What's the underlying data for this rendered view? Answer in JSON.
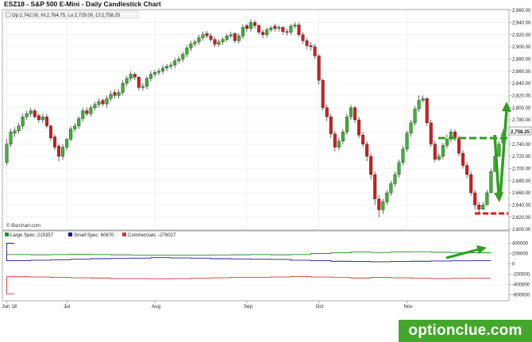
{
  "chart_data": {
    "type": "candlestick",
    "title": "ESZ18 - S&P 500 E-Mini - Daily Candlestick Chart",
    "ohlc_label": "Op:2,742.00, Hi:2,764.75, Lo:2,729.00, Cl:2,758.25",
    "last_price_label": "2,758.25",
    "last_price": 2758.25,
    "source_label": "© Barchart.com",
    "price_axis": {
      "ylim": [
        2600,
        2960
      ],
      "tick_values": [
        2600,
        2620,
        2640,
        2660,
        2680,
        2700,
        2720,
        2740,
        2760,
        2780,
        2800,
        2820,
        2840,
        2860,
        2880,
        2900,
        2920,
        2940,
        2960
      ],
      "tick_labels": [
        "2,600.00",
        "2,620.00",
        "2,640.00",
        "2,660.00",
        "2,680.00",
        "2,700.00",
        "2,720.00",
        "2,740.00",
        "2,760.00",
        "2,780.00",
        "2,800.00",
        "2,820.00",
        "2,840.00",
        "2,860.00",
        "2,880.00",
        "2,900.00",
        "2,920.00",
        "2,940.00",
        "2,960.00"
      ]
    },
    "x_labels": [
      {
        "label": "Jun 18",
        "index": 0
      },
      {
        "label": "Jul",
        "index": 15
      },
      {
        "label": "Aug",
        "index": 37
      },
      {
        "label": "Sep",
        "index": 60
      },
      {
        "label": "Oct",
        "index": 78
      },
      {
        "label": "Nov",
        "index": 100
      }
    ],
    "closes": [
      2740,
      2760,
      2762,
      2770,
      2785,
      2790,
      2795,
      2785,
      2780,
      2785,
      2770,
      2750,
      2735,
      2720,
      2735,
      2748,
      2765,
      2770,
      2782,
      2795,
      2790,
      2800,
      2805,
      2810,
      2806,
      2815,
      2822,
      2820,
      2825,
      2840,
      2848,
      2855,
      2850,
      2833,
      2835,
      2848,
      2855,
      2858,
      2860,
      2865,
      2868,
      2870,
      2877,
      2880,
      2888,
      2898,
      2905,
      2908,
      2915,
      2920,
      2918,
      2912,
      2904,
      2908,
      2912,
      2918,
      2920,
      2910,
      2918,
      2932,
      2930,
      2940,
      2935,
      2924,
      2920,
      2928,
      2931,
      2930,
      2932,
      2925,
      2924,
      2934,
      2936,
      2920,
      2910,
      2902,
      2900,
      2885,
      2845,
      2800,
      2785,
      2757,
      2735,
      2745,
      2760,
      2785,
      2800,
      2780,
      2755,
      2740,
      2720,
      2690,
      2650,
      2632,
      2645,
      2660,
      2675,
      2690,
      2710,
      2732,
      2758,
      2775,
      2798,
      2812,
      2815,
      2775,
      2740,
      2715,
      2720,
      2738,
      2748,
      2760,
      2750,
      2725,
      2705,
      2690,
      2660,
      2640,
      2633,
      2640,
      2660,
      2695,
      2720,
      2740,
      2758.25
    ],
    "opens": [
      2710,
      2740,
      2758,
      2762,
      2770,
      2785,
      2790,
      2795,
      2787,
      2780,
      2785,
      2770,
      2752,
      2737,
      2720,
      2735,
      2748,
      2765,
      2770,
      2782,
      2795,
      2790,
      2800,
      2805,
      2812,
      2806,
      2815,
      2825,
      2820,
      2825,
      2840,
      2848,
      2855,
      2850,
      2833,
      2835,
      2848,
      2855,
      2858,
      2860,
      2865,
      2868,
      2870,
      2877,
      2880,
      2888,
      2898,
      2905,
      2908,
      2915,
      2922,
      2918,
      2912,
      2904,
      2908,
      2912,
      2918,
      2922,
      2910,
      2918,
      2935,
      2930,
      2940,
      2935,
      2924,
      2920,
      2928,
      2934,
      2930,
      2932,
      2925,
      2924,
      2934,
      2936,
      2920,
      2910,
      2902,
      2900,
      2885,
      2845,
      2800,
      2785,
      2757,
      2735,
      2745,
      2760,
      2785,
      2800,
      2780,
      2755,
      2740,
      2720,
      2690,
      2650,
      2632,
      2645,
      2660,
      2675,
      2690,
      2710,
      2732,
      2758,
      2775,
      2798,
      2812,
      2815,
      2775,
      2740,
      2715,
      2720,
      2738,
      2752,
      2760,
      2750,
      2725,
      2705,
      2690,
      2660,
      2640,
      2633,
      2640,
      2660,
      2695,
      2720,
      2742
    ],
    "highs": [
      2748,
      2765,
      2768,
      2775,
      2790,
      2795,
      2800,
      2798,
      2790,
      2790,
      2790,
      2772,
      2756,
      2740,
      2740,
      2750,
      2770,
      2775,
      2786,
      2800,
      2800,
      2805,
      2810,
      2815,
      2815,
      2820,
      2828,
      2830,
      2830,
      2845,
      2852,
      2860,
      2858,
      2852,
      2840,
      2852,
      2860,
      2862,
      2865,
      2870,
      2872,
      2875,
      2882,
      2885,
      2892,
      2903,
      2910,
      2912,
      2920,
      2925,
      2926,
      2922,
      2916,
      2912,
      2916,
      2922,
      2925,
      2924,
      2922,
      2937,
      2938,
      2945,
      2944,
      2937,
      2928,
      2932,
      2935,
      2938,
      2936,
      2934,
      2930,
      2938,
      2941,
      2940,
      2924,
      2914,
      2908,
      2905,
      2888,
      2848,
      2805,
      2790,
      2762,
      2750,
      2765,
      2790,
      2805,
      2803,
      2785,
      2760,
      2745,
      2725,
      2695,
      2656,
      2650,
      2665,
      2680,
      2695,
      2715,
      2737,
      2762,
      2780,
      2803,
      2820,
      2820,
      2817,
      2780,
      2745,
      2725,
      2742,
      2756,
      2765,
      2764,
      2754,
      2730,
      2710,
      2695,
      2665,
      2645,
      2645,
      2665,
      2700,
      2725,
      2745,
      2764.75
    ],
    "lows": [
      2705,
      2735,
      2752,
      2757,
      2765,
      2780,
      2785,
      2782,
      2775,
      2775,
      2766,
      2745,
      2730,
      2712,
      2714,
      2730,
      2744,
      2760,
      2765,
      2777,
      2786,
      2785,
      2795,
      2800,
      2802,
      2800,
      2810,
      2815,
      2815,
      2820,
      2835,
      2843,
      2845,
      2828,
      2828,
      2830,
      2843,
      2850,
      2853,
      2855,
      2860,
      2863,
      2865,
      2872,
      2875,
      2883,
      2893,
      2900,
      2903,
      2910,
      2914,
      2908,
      2900,
      2900,
      2903,
      2908,
      2914,
      2906,
      2905,
      2913,
      2925,
      2925,
      2930,
      2920,
      2914,
      2915,
      2924,
      2925,
      2925,
      2920,
      2918,
      2919,
      2930,
      2916,
      2905,
      2896,
      2894,
      2880,
      2838,
      2795,
      2778,
      2750,
      2728,
      2730,
      2740,
      2755,
      2780,
      2775,
      2750,
      2735,
      2712,
      2682,
      2640,
      2620,
      2625,
      2640,
      2655,
      2670,
      2685,
      2705,
      2727,
      2752,
      2770,
      2793,
      2808,
      2770,
      2735,
      2710,
      2712,
      2715,
      2733,
      2743,
      2745,
      2720,
      2700,
      2684,
      2655,
      2632,
      2628,
      2632,
      2655,
      2690,
      2715,
      2735,
      2729
    ]
  },
  "cot_data": {
    "type": "step-line",
    "legend": [
      {
        "name": "Large Spec: 215357",
        "color": "#2e8b2e"
      },
      {
        "name": "Small Spec: 60670",
        "color": "#1a1a8c"
      },
      {
        "name": "Commercials: -276027",
        "color": "#d23a3a"
      }
    ],
    "ylim": [
      -700000,
      500000
    ],
    "tick_values": [
      400000,
      200000,
      0,
      -200000,
      -400000,
      -600000
    ],
    "tick_labels": [
      "400000",
      "200000",
      "0",
      "-200000",
      "-400000",
      "-600000"
    ],
    "week_index": [
      0,
      6,
      11,
      16,
      21,
      26,
      31,
      36,
      41,
      46,
      51,
      56,
      61,
      66,
      71,
      76,
      81,
      86,
      91,
      96,
      101,
      106,
      111,
      116,
      121
    ],
    "series": [
      {
        "name": "Large Spec",
        "color": "#2e8b2e",
        "values": [
          180000,
          180000,
          175000,
          180000,
          185000,
          180000,
          175000,
          170000,
          170000,
          168000,
          170000,
          172000,
          175000,
          180000,
          175000,
          180000,
          200000,
          215000,
          230000,
          220000,
          230000,
          235000,
          225000,
          218000,
          215357
        ]
      },
      {
        "name": "Small Spec",
        "color": "#1a1a8c",
        "values": [
          400000,
          60000,
          70000,
          80000,
          90000,
          100000,
          105000,
          110000,
          120000,
          115000,
          110000,
          100000,
          95000,
          90000,
          85000,
          70000,
          60000,
          50000,
          45000,
          40000,
          45000,
          50000,
          55000,
          58000,
          60670
        ]
      },
      {
        "name": "Commercials",
        "color": "#d23a3a",
        "values": [
          -580000,
          -250000,
          -255000,
          -260000,
          -270000,
          -275000,
          -285000,
          -285000,
          -290000,
          -285000,
          -280000,
          -270000,
          -260000,
          -260000,
          -255000,
          -245000,
          -255000,
          -265000,
          -275000,
          -260000,
          -270000,
          -280000,
          -285000,
          -280000,
          -276027
        ]
      }
    ]
  },
  "annotations": {
    "resistance_color": "#2e9f1f",
    "support_color": "#e01a1a",
    "arrow_color": "#2e9f1f"
  },
  "watermark": {
    "text": "optionclue.com",
    "bg_color": "#43a72a"
  }
}
